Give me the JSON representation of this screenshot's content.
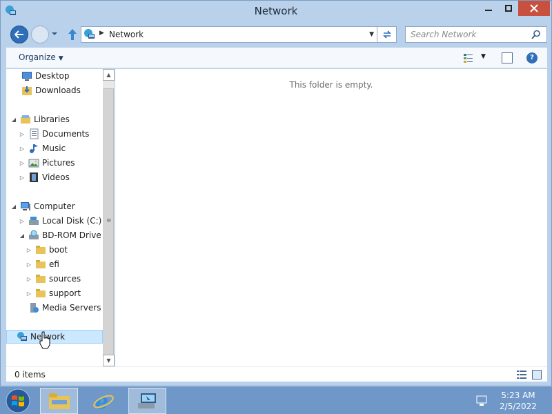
{
  "window": {
    "title": "Network"
  },
  "address": {
    "path": "Network",
    "search_placeholder": "Search Network"
  },
  "toolbar": {
    "organize_label": "Organize"
  },
  "nav": {
    "favorites": [
      {
        "label": "Desktop",
        "icon": "desktop-icon"
      },
      {
        "label": "Downloads",
        "icon": "downloads-icon"
      }
    ],
    "libraries": {
      "label": "Libraries",
      "items": [
        {
          "label": "Documents",
          "icon": "documents-icon"
        },
        {
          "label": "Music",
          "icon": "music-icon"
        },
        {
          "label": "Pictures",
          "icon": "pictures-icon"
        },
        {
          "label": "Videos",
          "icon": "videos-icon"
        }
      ]
    },
    "computer": {
      "label": "Computer",
      "items": [
        {
          "label": "Local Disk (C:)",
          "icon": "local-disk-icon"
        },
        {
          "label": "BD-ROM Drive (D:)",
          "icon": "bd-rom-drive-icon"
        }
      ],
      "bd_children": [
        "boot",
        "efi",
        "sources",
        "support"
      ],
      "media_servers": "Media Servers"
    },
    "network": "Network"
  },
  "content": {
    "empty_message": "This folder is empty."
  },
  "status": {
    "item_count": "0 items"
  },
  "taskbar": {
    "time": "5:23 AM",
    "date": "2/5/2022"
  },
  "colors": {
    "frame": "#b9d1ea",
    "taskbar": "#6f98c8",
    "close_button": "#c7513e",
    "selection": "#cce8ff"
  }
}
